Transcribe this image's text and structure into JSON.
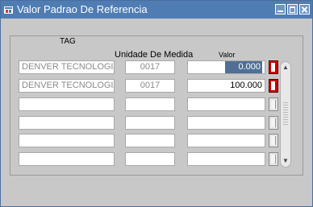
{
  "window": {
    "title": "Valor Padrao De Referencia",
    "icon": "app-window-icon",
    "controls": [
      "minimize-icon",
      "maximize-icon",
      "close-icon"
    ]
  },
  "headers": {
    "tag": "TAG",
    "unidade": "Unidade De Medida",
    "valor": "Valor"
  },
  "rows": [
    {
      "tag": "DENVER TECNOLOGIA",
      "unidade": "0017",
      "valor": "0.000",
      "lov_active": true,
      "selected": true
    },
    {
      "tag": "DENVER TECNOLOGIA",
      "unidade": "0017",
      "valor": "100.000",
      "lov_active": true,
      "selected": false
    },
    {
      "tag": "",
      "unidade": "",
      "valor": "",
      "lov_active": false,
      "selected": false
    },
    {
      "tag": "",
      "unidade": "",
      "valor": "",
      "lov_active": false,
      "selected": false
    },
    {
      "tag": "",
      "unidade": "",
      "valor": "",
      "lov_active": false,
      "selected": false
    },
    {
      "tag": "",
      "unidade": "",
      "valor": "",
      "lov_active": false,
      "selected": false
    }
  ],
  "colors": {
    "titlebar": "#4f7cb3",
    "selection": "#4f6f94",
    "lov_active": "#cc0000",
    "background": "#c8c8c8"
  }
}
